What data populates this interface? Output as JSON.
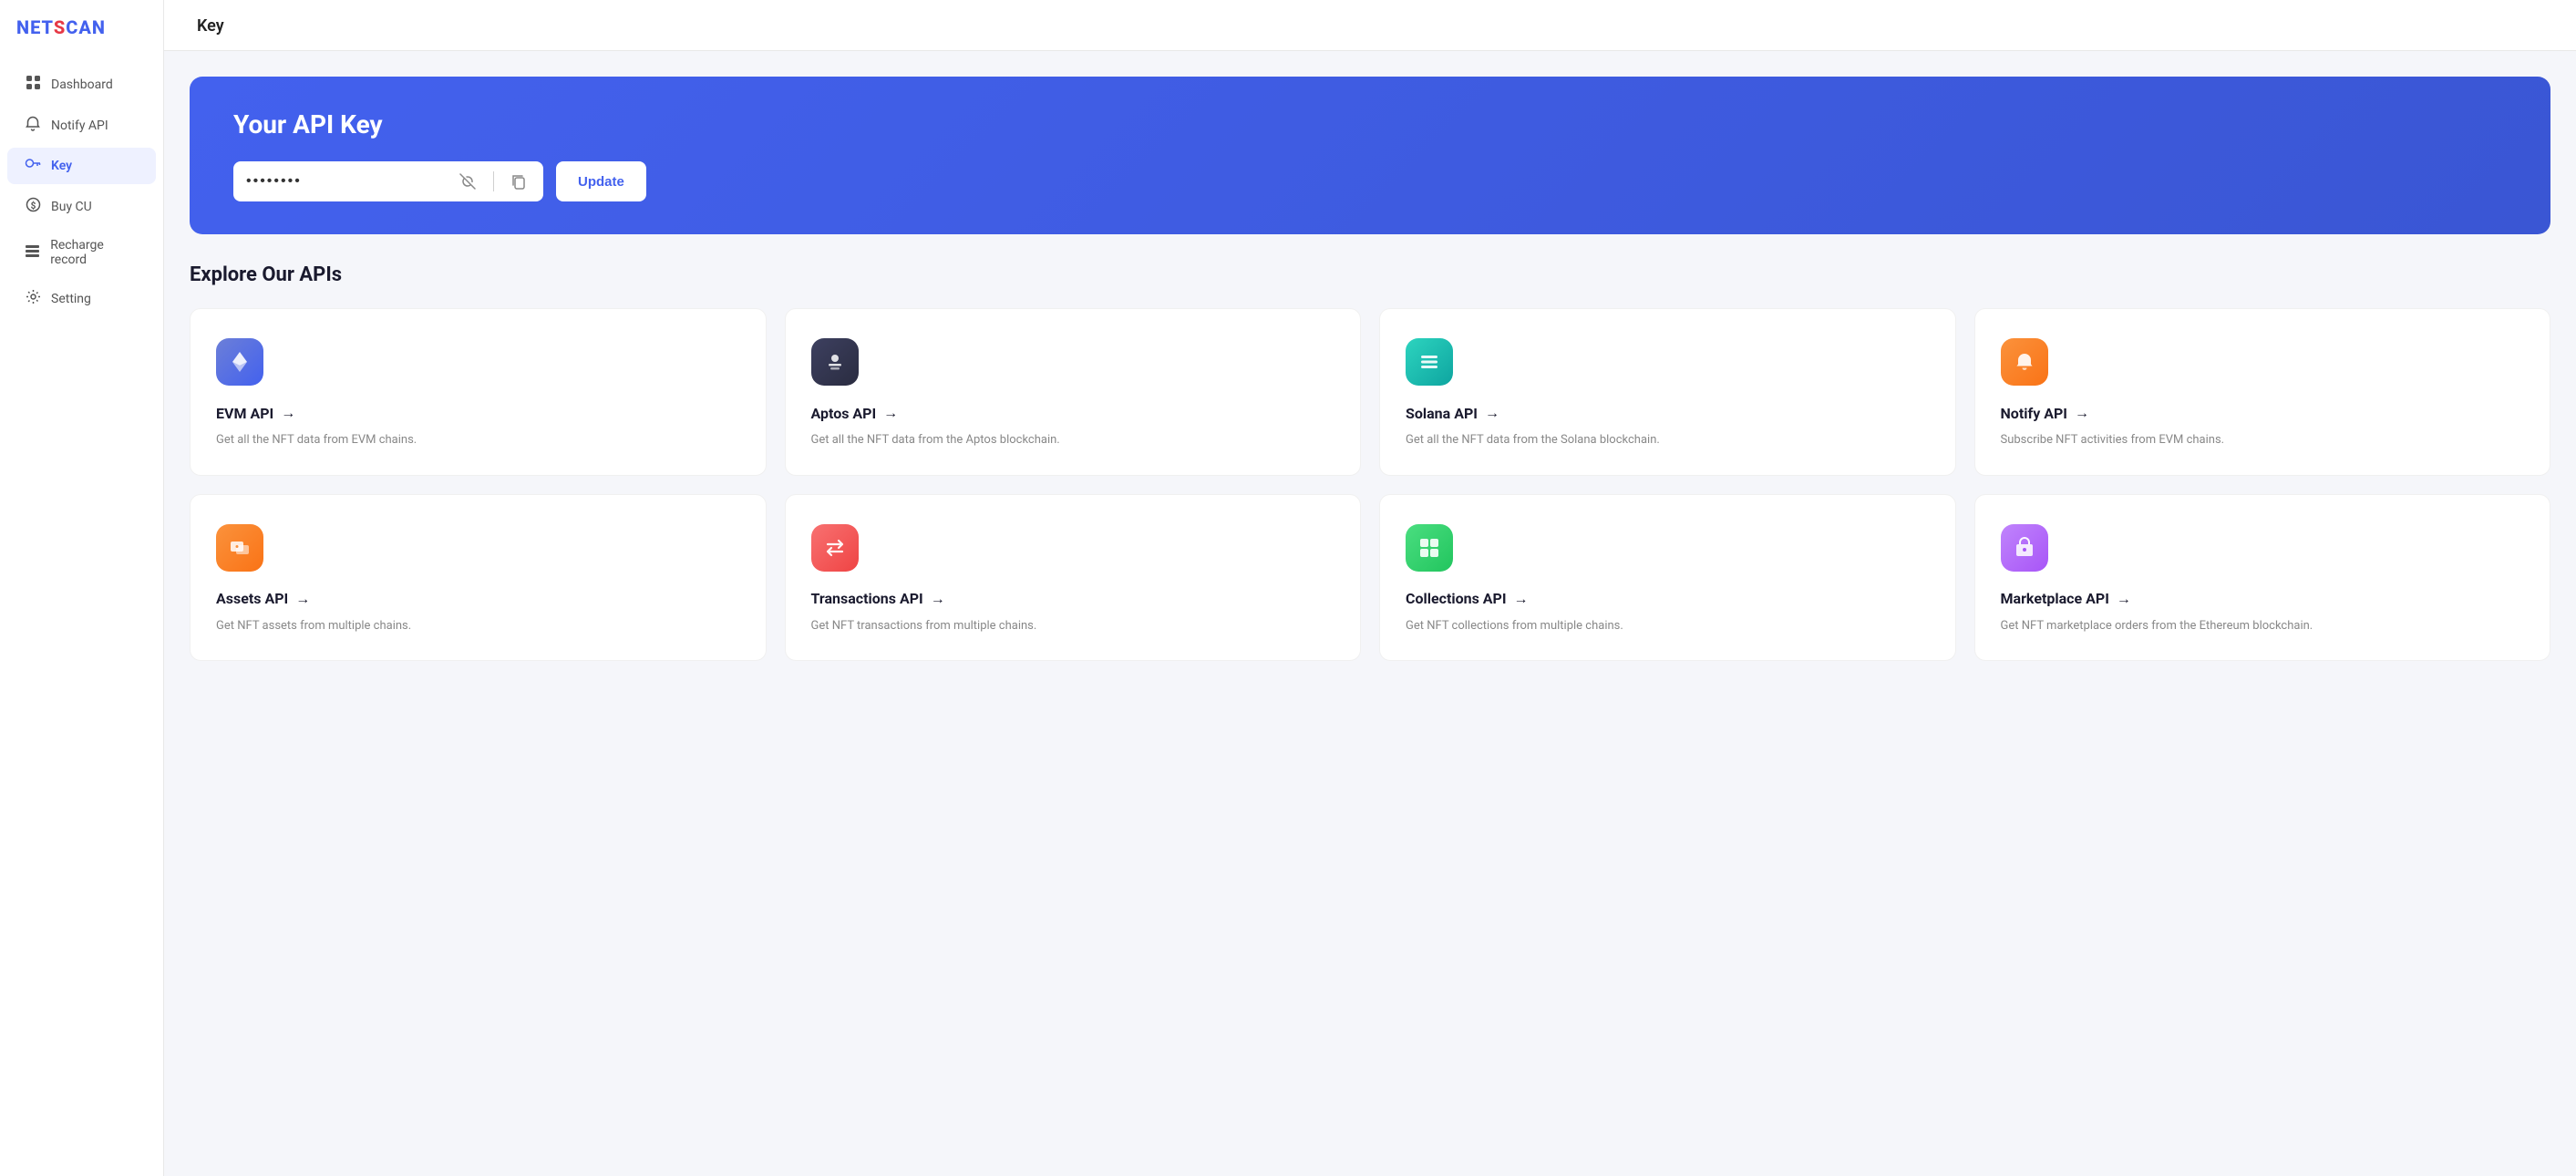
{
  "logo": {
    "text": "NETSCAN"
  },
  "sidebar": {
    "items": [
      {
        "id": "dashboard",
        "label": "Dashboard",
        "icon": "grid"
      },
      {
        "id": "notify-api",
        "label": "Notify API",
        "icon": "bell"
      },
      {
        "id": "key",
        "label": "Key",
        "icon": "key",
        "active": true
      },
      {
        "id": "buy-cu",
        "label": "Buy CU",
        "icon": "circle-dollar"
      },
      {
        "id": "recharge-record",
        "label": "Recharge record",
        "icon": "list"
      },
      {
        "id": "setting",
        "label": "Setting",
        "icon": "settings"
      }
    ]
  },
  "page": {
    "title": "Key",
    "hero": {
      "title": "Your API Key",
      "api_key_placeholder": "••••••••",
      "update_button": "Update"
    },
    "explore": {
      "title": "Explore Our APIs",
      "apis": [
        {
          "id": "evm-api",
          "title": "EVM API",
          "description": "Get all the NFT data from EVM chains.",
          "icon_bg": "bg-blue-gradient",
          "icon_type": "ethereum"
        },
        {
          "id": "aptos-api",
          "title": "Aptos API",
          "description": "Get all the NFT data from the Aptos blockchain.",
          "icon_bg": "bg-dark",
          "icon_type": "aptos"
        },
        {
          "id": "solana-api",
          "title": "Solana API",
          "description": "Get all the NFT data from the Solana blockchain.",
          "icon_bg": "bg-teal",
          "icon_type": "solana"
        },
        {
          "id": "notify-api",
          "title": "Notify API",
          "description": "Subscribe NFT activities from EVM chains.",
          "icon_bg": "bg-orange",
          "icon_type": "notify"
        },
        {
          "id": "assets-api",
          "title": "Assets API",
          "description": "Get NFT assets from multiple chains.",
          "icon_bg": "bg-orange2",
          "icon_type": "assets"
        },
        {
          "id": "transactions-api",
          "title": "Transactions API",
          "description": "Get NFT transactions from multiple chains.",
          "icon_bg": "bg-red",
          "icon_type": "transactions"
        },
        {
          "id": "collections-api",
          "title": "Collections API",
          "description": "Get NFT collections from multiple chains.",
          "icon_bg": "bg-green",
          "icon_type": "collections"
        },
        {
          "id": "marketplace-api",
          "title": "Marketplace API",
          "description": "Get NFT marketplace orders from the Ethereum blockchain.",
          "icon_bg": "bg-purple",
          "icon_type": "marketplace"
        }
      ]
    }
  }
}
